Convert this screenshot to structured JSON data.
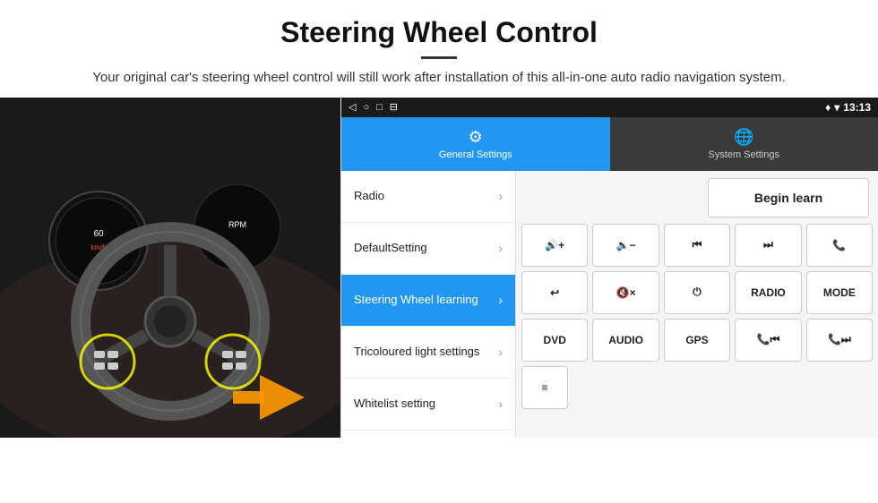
{
  "header": {
    "title": "Steering Wheel Control",
    "divider": true,
    "subtitle": "Your original car's steering wheel control will still work after installation of this all-in-one auto radio navigation system."
  },
  "status_bar": {
    "nav_back": "◁",
    "nav_home": "○",
    "nav_recent": "□",
    "nav_cast": "⊟",
    "time": "13:13",
    "signal_icon": "♦",
    "wifi_icon": "▾"
  },
  "tabs": [
    {
      "id": "general",
      "label": "General Settings",
      "icon": "⚙",
      "active": true
    },
    {
      "id": "system",
      "label": "System Settings",
      "icon": "🌐",
      "active": false
    }
  ],
  "menu_items": [
    {
      "id": "radio",
      "label": "Radio",
      "active": false
    },
    {
      "id": "default_setting",
      "label": "DefaultSetting",
      "active": false
    },
    {
      "id": "steering_wheel",
      "label": "Steering Wheel learning",
      "active": true
    },
    {
      "id": "tricoloured",
      "label": "Tricoloured light settings",
      "active": false
    },
    {
      "id": "whitelist",
      "label": "Whitelist setting",
      "active": false
    }
  ],
  "controls": {
    "begin_learn_label": "Begin learn",
    "rows": [
      [
        {
          "id": "vol_up",
          "label": "🔊+",
          "type": "icon"
        },
        {
          "id": "vol_down",
          "label": "🔉−",
          "type": "icon"
        },
        {
          "id": "prev_track",
          "label": "⏮",
          "type": "icon"
        },
        {
          "id": "next_track",
          "label": "⏭",
          "type": "icon"
        },
        {
          "id": "phone",
          "label": "📞",
          "type": "icon"
        }
      ],
      [
        {
          "id": "hang_up",
          "label": "↩",
          "type": "icon"
        },
        {
          "id": "mute",
          "label": "🔇×",
          "type": "icon"
        },
        {
          "id": "power",
          "label": "⏻",
          "type": "icon"
        },
        {
          "id": "radio_btn",
          "label": "RADIO",
          "type": "text"
        },
        {
          "id": "mode_btn",
          "label": "MODE",
          "type": "text"
        }
      ],
      [
        {
          "id": "dvd_btn",
          "label": "DVD",
          "type": "text"
        },
        {
          "id": "audio_btn",
          "label": "AUDIO",
          "type": "text"
        },
        {
          "id": "gps_btn",
          "label": "GPS",
          "type": "text"
        },
        {
          "id": "phone_prev",
          "label": "📞⏮",
          "type": "icon"
        },
        {
          "id": "phone_next",
          "label": "📞⏭",
          "type": "icon"
        }
      ]
    ],
    "whitelist_icon": "≡"
  }
}
